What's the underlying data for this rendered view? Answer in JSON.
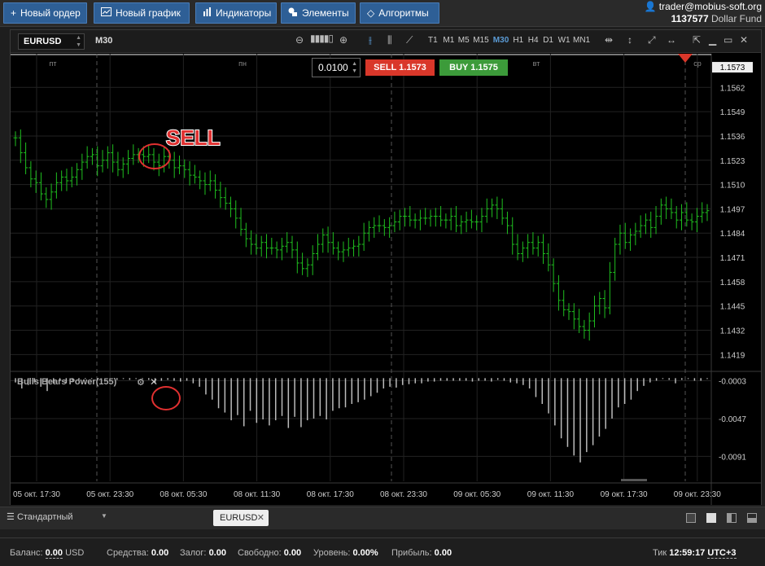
{
  "toolbar": {
    "new_order": "Новый ордер",
    "new_chart": "Новый график",
    "indicators": "Индикаторы",
    "elements": "Элементы",
    "algorithms": "Алгоритмы"
  },
  "account": {
    "email": "trader@mobius-soft.org",
    "id": "1137577",
    "fund": "Dollar Fund"
  },
  "chart_window": {
    "symbol": "EURUSD",
    "timeframe": "M30",
    "timeframes": [
      "T1",
      "M1",
      "M5",
      "M15",
      "M30",
      "H1",
      "H4",
      "D1",
      "W1",
      "MN1"
    ],
    "active_timeframe": "M30"
  },
  "order": {
    "lot": "0.0100",
    "sell_label": "SELL",
    "sell_price": "1.1573",
    "buy_label": "BUY",
    "buy_price": "1.1575"
  },
  "annotation": "SELL",
  "indicator_title": "Bulls Bears Power(155)",
  "chart_data": {
    "type": "bar",
    "symbol": "EURUSD",
    "day_labels": [
      "пт",
      "пн",
      "вт",
      "ср"
    ],
    "price_ticks": [
      "1.1573",
      "1.1562",
      "1.1549",
      "1.1536",
      "1.1523",
      "1.1510",
      "1.1497",
      "1.1484",
      "1.1471",
      "1.1458",
      "1.1445",
      "1.1432",
      "1.1419"
    ],
    "current_price": "1.1573",
    "ylim": [
      1.141,
      1.158
    ],
    "indicator_ticks": [
      "-0.0003",
      "-0.0047",
      "-0.0091"
    ],
    "indicator_ylim": [
      -0.012,
      0.0006
    ],
    "x_ticks": [
      "05 окт. 17:30",
      "05 окт. 23:30",
      "08 окт. 05:30",
      "08 окт. 11:30",
      "08 окт. 17:30",
      "08 окт. 23:30",
      "09 окт. 05:30",
      "09 окт. 11:30",
      "09 окт. 17:30",
      "09 окт. 23:30"
    ],
    "closes": [
      1.1535,
      1.1527,
      1.1519,
      1.1513,
      1.1511,
      1.1505,
      1.1502,
      1.1506,
      1.1511,
      1.1514,
      1.1512,
      1.1514,
      1.1518,
      1.1522,
      1.1525,
      1.1526,
      1.152,
      1.1523,
      1.1527,
      1.1522,
      1.1518,
      1.1521,
      1.1524,
      1.1526,
      1.1526,
      1.1525,
      1.1526,
      1.1522,
      1.152,
      1.1525,
      1.1523,
      1.1519,
      1.152,
      1.1518,
      1.1515,
      1.1514,
      1.1512,
      1.151,
      1.1512,
      1.1507,
      1.1503,
      1.15,
      1.1497,
      1.1492,
      1.1486,
      1.1481,
      1.1478,
      1.1476,
      1.1479,
      1.1476,
      1.1476,
      1.1475,
      1.1477,
      1.1479,
      1.1475,
      1.1468,
      1.1465,
      1.1467,
      1.1473,
      1.1478,
      1.1483,
      1.1479,
      1.1476,
      1.1474,
      1.1475,
      1.1476,
      1.1477,
      1.1478,
      1.1484,
      1.1487,
      1.1488,
      1.1488,
      1.1487,
      1.1488,
      1.149,
      1.1493,
      1.1493,
      1.1491,
      1.1491,
      1.1492,
      1.1492,
      1.1493,
      1.1493,
      1.1491,
      1.1491,
      1.1493,
      1.1488,
      1.149,
      1.1491,
      1.149,
      1.149,
      1.1493,
      1.1497,
      1.1499,
      1.1497,
      1.1492,
      1.1488,
      1.1478,
      1.1473,
      1.1476,
      1.1479,
      1.1476,
      1.1479,
      1.1473,
      1.1467,
      1.1457,
      1.1448,
      1.1443,
      1.1442,
      1.1438,
      1.1434,
      1.1432,
      1.1437,
      1.1445,
      1.1449,
      1.1444,
      1.1463,
      1.1478,
      1.1484,
      1.1479,
      1.1483,
      1.1485,
      1.1488,
      1.1491,
      1.1487,
      1.1493,
      1.1499,
      1.1497,
      1.1495,
      1.1491,
      1.1495,
      1.1491,
      1.149,
      1.1493,
      1.1495,
      1.1496
    ],
    "indicator": [
      -0.0005,
      -0.0012,
      -0.0008,
      -0.0005,
      -0.001,
      -0.0015,
      -0.0006,
      -0.0003,
      -0.0006,
      -0.0003,
      -0.0002,
      -0.0001,
      -0.0001,
      -0.0002,
      0.0,
      0.0,
      -0.0002,
      -0.0001,
      -0.0002,
      -0.0001,
      -0.0001,
      -0.0002,
      -0.0006,
      -0.0003,
      -0.0002,
      -0.0003,
      -0.0004,
      -0.0003,
      -0.0006,
      -0.001,
      -0.0019,
      -0.0025,
      -0.0035,
      -0.004,
      -0.0049,
      -0.0043,
      -0.0056,
      -0.0038,
      -0.0052,
      -0.0048,
      -0.0055,
      -0.0049,
      -0.0044,
      -0.0058,
      -0.0045,
      -0.0057,
      -0.0049,
      -0.0047,
      -0.0044,
      -0.0048,
      -0.0038,
      -0.0035,
      -0.0034,
      -0.003,
      -0.0028,
      -0.0025,
      -0.0021,
      -0.0017,
      -0.0012,
      -0.001,
      -0.0011,
      -0.0008,
      -0.0007,
      -0.0006,
      -0.0006,
      -0.0004,
      -0.0004,
      -0.0003,
      -0.0003,
      -0.0003,
      -0.0003,
      -0.0003,
      -0.0004,
      -0.0003,
      -0.0003,
      -0.0004,
      -0.0002,
      -0.0003,
      -0.0005,
      -0.0006,
      -0.0008,
      -0.0012,
      -0.0022,
      -0.003,
      -0.0041,
      -0.0055,
      -0.007,
      -0.008,
      -0.009,
      -0.0098,
      -0.0086,
      -0.0078,
      -0.0068,
      -0.0059,
      -0.0047,
      -0.0034,
      -0.003,
      -0.0025,
      -0.0015,
      -0.0009,
      -0.0005,
      -0.0003,
      -0.0001,
      -0.0002,
      -0.0006,
      -0.0002,
      -0.0001,
      -0.0003,
      -0.0003,
      -0.0001
    ]
  },
  "bottom": {
    "layout_name": "Стандартный",
    "tab": "EURUSD"
  },
  "status": {
    "balance_label": "Баланс:",
    "balance_value": "0.00",
    "balance_currency": "USD",
    "funds_label": "Средства:",
    "funds_value": "0.00",
    "margin_label": "Залог:",
    "margin_value": "0.00",
    "free_label": "Свободно:",
    "free_value": "0.00",
    "level_label": "Уровень:",
    "level_value": "0.00%",
    "profit_label": "Прибыль:",
    "profit_value": "0.00",
    "tick_label": "Тик",
    "time": "12:59:17",
    "tz": "UTC+3"
  },
  "colors": {
    "bull": "#1fbf1f",
    "bear": "#1fbf1f",
    "indicator": "#bbbbbb",
    "sell": "#d9372a",
    "buy": "#3c9b3a",
    "accent": "#2e5f96",
    "circle": "#e03030"
  }
}
